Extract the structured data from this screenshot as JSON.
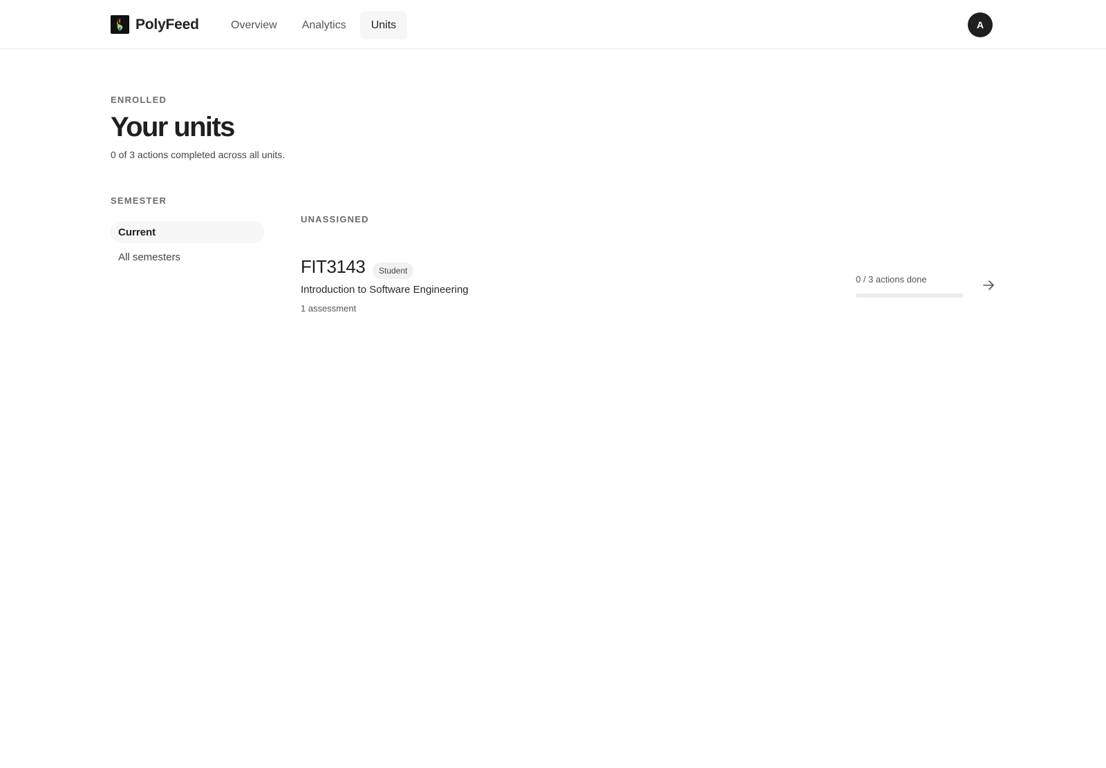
{
  "app": {
    "name": "PolyFeed",
    "logo_icon": "polyfeed-logo-icon"
  },
  "nav": {
    "tabs": [
      {
        "label": "Overview",
        "active": false
      },
      {
        "label": "Analytics",
        "active": false
      },
      {
        "label": "Units",
        "active": true
      }
    ]
  },
  "user": {
    "avatar_initial": "A"
  },
  "page": {
    "eyebrow": "ENROLLED",
    "title": "Your units",
    "subtitle": "0 of 3 actions completed across all units."
  },
  "semester_filter": {
    "heading": "SEMESTER",
    "options": [
      {
        "label": "Current",
        "selected": true
      },
      {
        "label": "All semesters",
        "selected": false
      }
    ]
  },
  "groups": [
    {
      "heading": "UNASSIGNED",
      "units": [
        {
          "code": "FIT3143",
          "role": "Student",
          "name": "Introduction to Software Engineering",
          "meta": "1 assessment",
          "progress_label": "0 / 3 actions done",
          "progress_done": 0,
          "progress_total": 3,
          "action_icon": "arrow-right-icon"
        }
      ]
    }
  ],
  "colors": {
    "accent": "#1f1f1f",
    "muted_text": "#6b6b6b",
    "active_tab_bg": "#f6f6f7",
    "track": "#ededee"
  }
}
